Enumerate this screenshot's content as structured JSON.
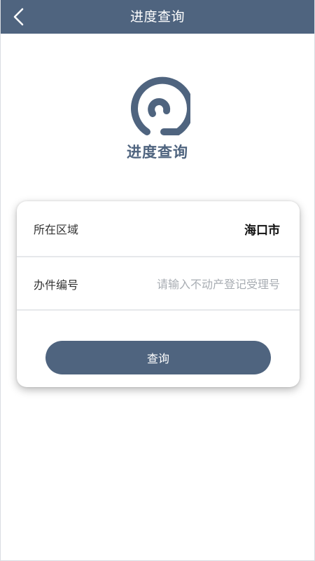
{
  "header": {
    "title": "进度查询",
    "back_icon": "chevron-left-icon"
  },
  "logo": {
    "icon": "swirl-logo-icon",
    "title": "进度查询"
  },
  "form": {
    "region_label": "所在区域",
    "region_value": "海口市",
    "number_label": "办件编号",
    "number_value": "",
    "number_placeholder": "请输入不动产登记受理号",
    "submit_label": "查询"
  },
  "colors": {
    "primary": "#4f647f",
    "background": "#ffffff",
    "divider": "#e6e8eb",
    "placeholder": "#a8adb3"
  }
}
